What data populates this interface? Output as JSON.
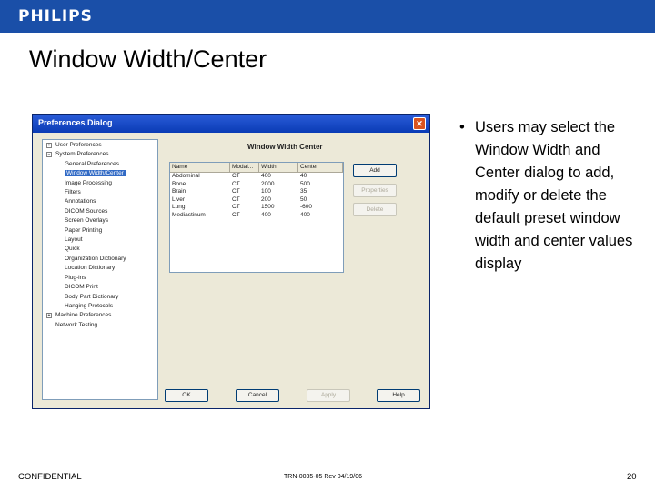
{
  "brand": {
    "logo": "PHILIPS",
    "bar_color": "#1a4fa8"
  },
  "slide": {
    "title": "Window Width/Center"
  },
  "dialog": {
    "title": "Preferences Dialog",
    "close_glyph": "✕",
    "panel_title": "Window Width Center",
    "tree": [
      {
        "label": "User Preferences",
        "level": 0,
        "expander": "+"
      },
      {
        "label": "System Preferences",
        "level": 0,
        "expander": "−"
      },
      {
        "label": "General Preferences",
        "level": 1
      },
      {
        "label": "Window Width/Center",
        "level": 1,
        "selected": true
      },
      {
        "label": "Image Processing",
        "level": 1
      },
      {
        "label": "Filters",
        "level": 1
      },
      {
        "label": "Annotations",
        "level": 1
      },
      {
        "label": "DICOM Sources",
        "level": 1
      },
      {
        "label": "Screen Overlays",
        "level": 1
      },
      {
        "label": "Paper Printing",
        "level": 1
      },
      {
        "label": "Layout",
        "level": 1
      },
      {
        "label": "Quick",
        "level": 1
      },
      {
        "label": "Organization Dictionary",
        "level": 1
      },
      {
        "label": "Location Dictionary",
        "level": 1
      },
      {
        "label": "Plug-ins",
        "level": 1
      },
      {
        "label": "DICOM Print",
        "level": 1
      },
      {
        "label": "Body Part Dictionary",
        "level": 1
      },
      {
        "label": "Hanging Protocols",
        "level": 1
      },
      {
        "label": "Machine Preferences",
        "level": 0,
        "expander": "+"
      },
      {
        "label": "Network Testing",
        "level": 0,
        "expander": ""
      }
    ],
    "list": {
      "headers": [
        "Name",
        "Modal...",
        "Width",
        "Center"
      ],
      "rows": [
        [
          "Abdominal",
          "CT",
          "400",
          "40"
        ],
        [
          "Bone",
          "CT",
          "2000",
          "500"
        ],
        [
          "Brain",
          "CT",
          "100",
          "35"
        ],
        [
          "Liver",
          "CT",
          "200",
          "50"
        ],
        [
          "Lung",
          "CT",
          "1500",
          "-600"
        ],
        [
          "Mediastinum",
          "CT",
          "400",
          "400"
        ]
      ]
    },
    "buttons": {
      "add": "Add",
      "properties": "Properties",
      "delete": "Delete",
      "ok": "OK",
      "cancel": "Cancel",
      "apply": "Apply",
      "help": "Help"
    }
  },
  "bullet": {
    "dot": "•",
    "text": "Users may select the Window Width and Center dialog to add, modify or delete the default preset window width and center values display"
  },
  "footer": {
    "left": "CONFIDENTIAL",
    "center": "TRN-0035-05 Rev 04/19/06",
    "page": "20"
  }
}
